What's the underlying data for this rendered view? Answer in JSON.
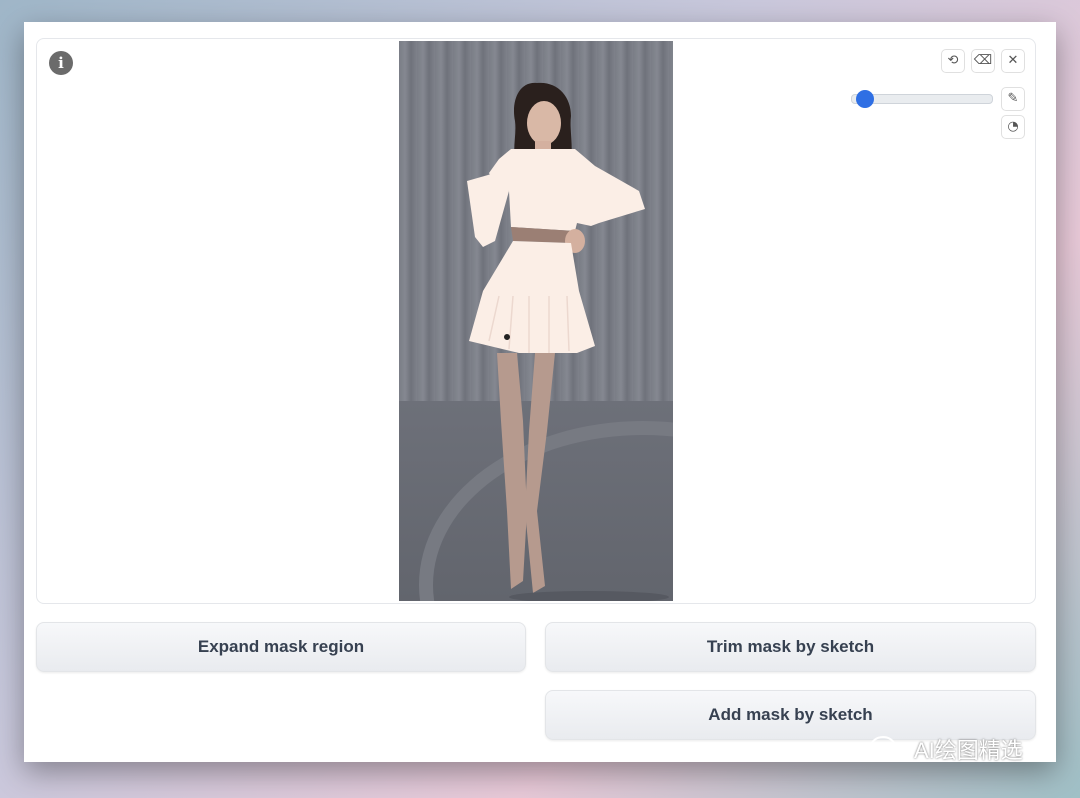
{
  "editor": {
    "info_icon": "i",
    "toolbar": {
      "undo_icon": "⟲",
      "erase_icon": "⌫",
      "close_icon": "✕",
      "brush_icon": "✎",
      "color_icon": "◔"
    },
    "brush_slider": {
      "value_fraction": 0.03,
      "accent": "#2f6fe4"
    }
  },
  "actions": {
    "expand_label": "Expand mask region",
    "trim_label": "Trim mask by sketch",
    "add_label": "Add mask by sketch"
  },
  "watermark": {
    "text": "AI绘图精选"
  }
}
